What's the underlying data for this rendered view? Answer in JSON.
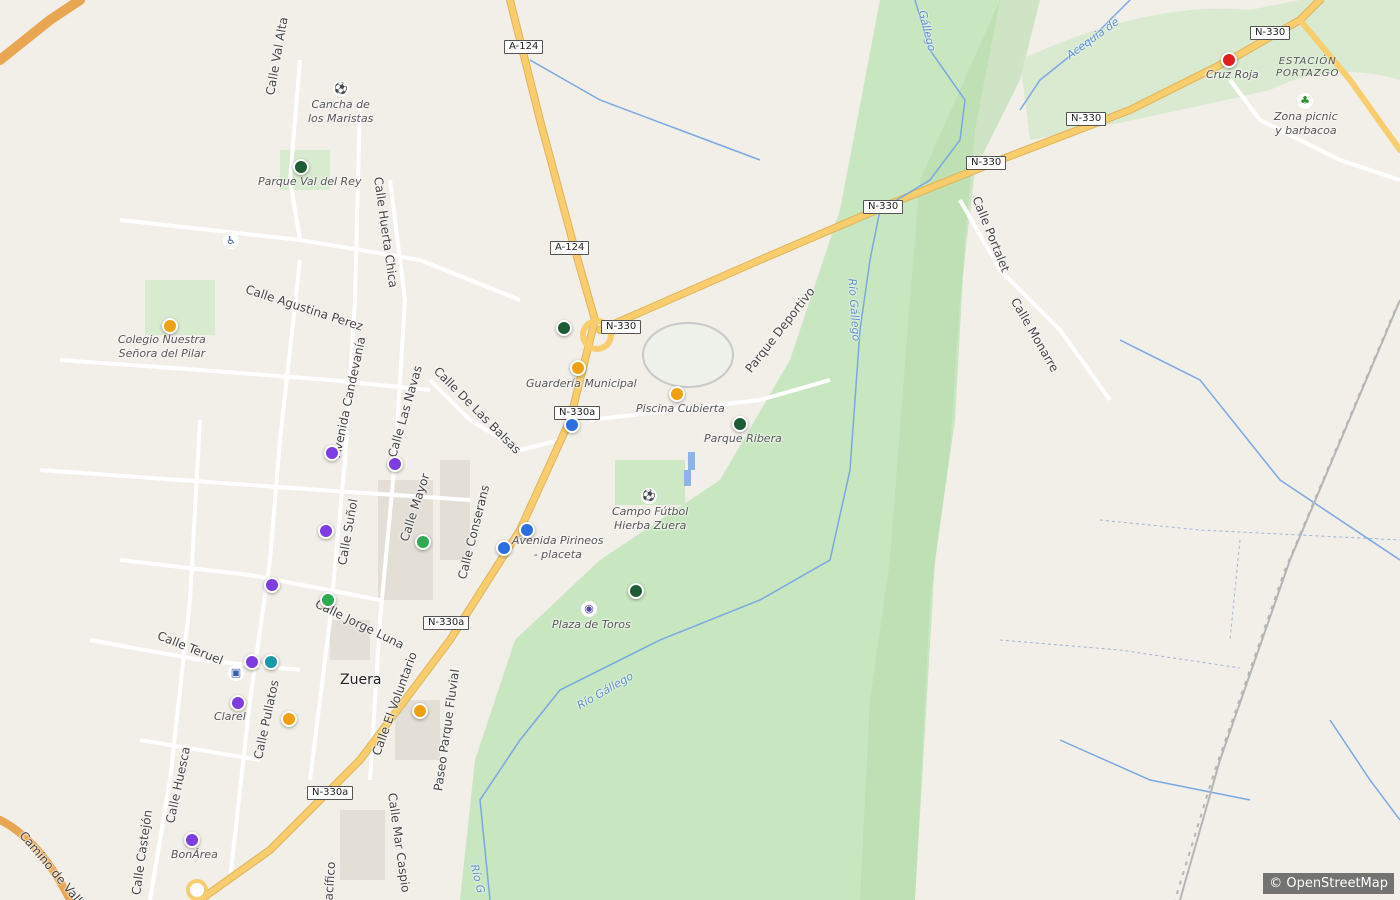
{
  "colors": {
    "background": "#f2efe9",
    "park_green": "#c8e6c0",
    "wood_green": "#a8d89a",
    "primary_road": "#f7cd6d",
    "water": "#7aa8e0"
  },
  "town_label": "Zuera",
  "attribution": "© OpenStreetMap",
  "route_shields": [
    "A-124",
    "A-124",
    "N-330",
    "N-330",
    "N-330",
    "N-330",
    "N-330",
    "N-330a",
    "N-330a",
    "N-330a"
  ],
  "place_labels": {
    "cancha": "Cancha de\nlos Maristas",
    "parque_val_del_rey": "Parque Val del Rey",
    "colegio": "Colegio Nuestra\nSeñora del Pilar",
    "guarderia": "Guardería Municipal",
    "piscina": "Piscina Cubierta",
    "parque_ribera": "Parque Ribera",
    "avenida_pirineos": "Avenida Pirineos\n- placeta",
    "campo_futbol": "Campo Fútbol\nHierba Zuera",
    "plaza_toros": "Plaza de Toros",
    "clarel": "Clarel",
    "bonarea": "BonÁrea",
    "cruz_roja": "Cruz Roja",
    "estacion": "ESTACIÓN\nPORTAZGO",
    "zona_picnic": "Zona picnic\ny barbacoa"
  },
  "street_labels": {
    "val_alta": "Calle Val Alta",
    "huerta_chica": "Calle Huerta Chica",
    "agustina_perez": "Calle Agustina Perez",
    "candevania": "Avenida Candevanía",
    "las_navas": "Calle Las Navas",
    "de_las_balsas": "Calle De Las Balsas",
    "mayor": "Calle Mayor",
    "conserans": "Calle Conserans",
    "sunol": "Calle Suñol",
    "jorge_luna": "Calle Jorge Luna",
    "teruel": "Calle Teruel",
    "pullatos": "Calle Pullatos",
    "el_voluntario": "Calle El Voluntario",
    "parque_fluvial": "Paseo Parque Fluvial",
    "huesca": "Calle Huesca",
    "castejon": "Calle Castejón",
    "camino_vallo": "Camino de Vallo",
    "mar_caspio": "Calle Mar Caspio",
    "pacifico": "Pacífico",
    "parque_deportivo": "Parque Deportivo",
    "portalet": "Calle Portalet",
    "monarre": "Calle Monarre"
  },
  "water_labels": {
    "gallego_n": "Gállego",
    "gallego_mid": "Río Gállego",
    "gallego_s": "Río Gállego",
    "gallego_bottom": "Río G",
    "acequia": "Acequia de"
  },
  "markers": [
    {
      "category": "park",
      "color": "#1e5b34"
    },
    {
      "category": "park",
      "color": "#1e5b34"
    },
    {
      "category": "park",
      "color": "#1e5b34"
    },
    {
      "category": "park",
      "color": "#1e5b34"
    },
    {
      "category": "school",
      "color": "#f0a010"
    },
    {
      "category": "public",
      "color": "#f0a010"
    },
    {
      "category": "sport",
      "color": "#f0a010"
    },
    {
      "category": "amenity",
      "color": "#f0a010"
    },
    {
      "category": "amenity",
      "color": "#f0a010"
    },
    {
      "category": "transport",
      "color": "#2c6fe0"
    },
    {
      "category": "transport",
      "color": "#2c6fe0"
    },
    {
      "category": "transport",
      "color": "#2c6fe0"
    },
    {
      "category": "shop",
      "color": "#7e3de0"
    },
    {
      "category": "shop",
      "color": "#7e3de0"
    },
    {
      "category": "shop",
      "color": "#7e3de0"
    },
    {
      "category": "shop",
      "color": "#7e3de0"
    },
    {
      "category": "shop",
      "color": "#7e3de0"
    },
    {
      "category": "shop",
      "color": "#7e3de0"
    },
    {
      "category": "shop",
      "color": "#7e3de0"
    },
    {
      "category": "leisure",
      "color": "#2eaa4f"
    },
    {
      "category": "leisure",
      "color": "#2eaa4f"
    },
    {
      "category": "health",
      "color": "#1a9aa8"
    },
    {
      "category": "emergency",
      "color": "#e02020"
    }
  ]
}
